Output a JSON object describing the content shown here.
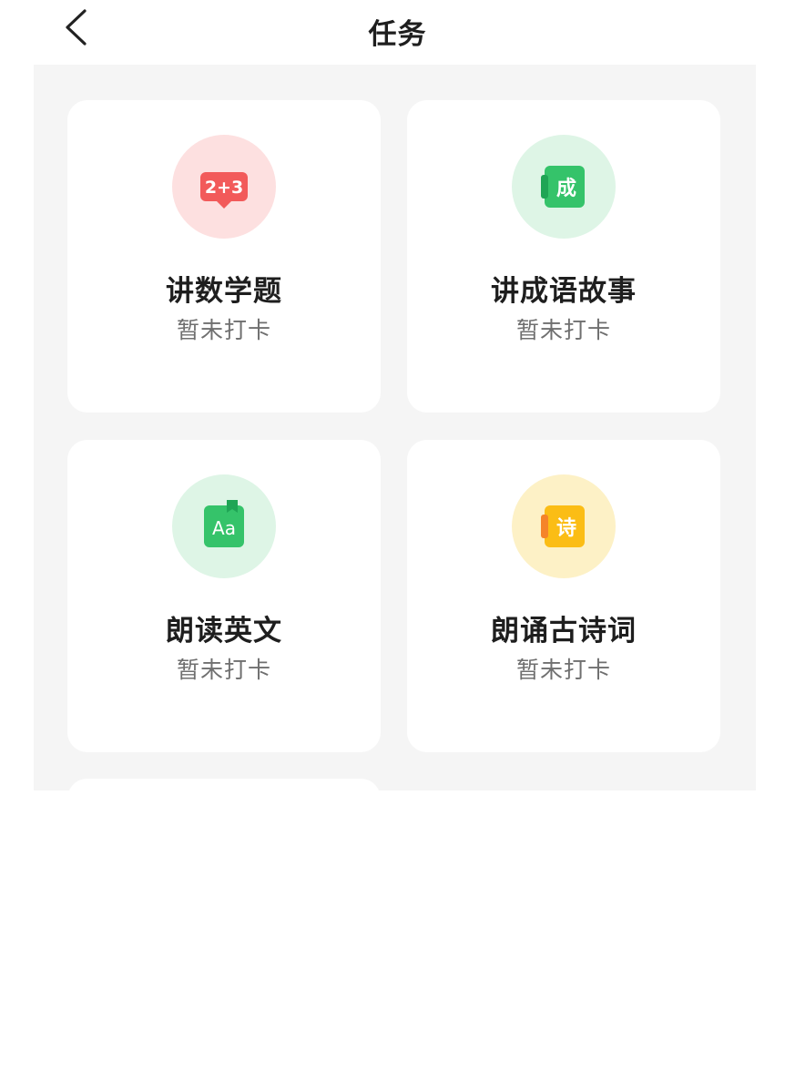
{
  "header": {
    "title": "任务",
    "back_icon": "chevron-left-icon"
  },
  "tasks": [
    {
      "title": "讲数学题",
      "status": "暂未打卡",
      "icon": "math-bubble-icon",
      "icon_text": "2+3",
      "circle_color": "#fde0e0",
      "icon_color": "#f25a5a"
    },
    {
      "title": "讲成语故事",
      "status": "暂未打卡",
      "icon": "idiom-book-icon",
      "icon_text": "成",
      "circle_color": "#def5e6",
      "icon_color": "#35c36a"
    },
    {
      "title": "朗读英文",
      "status": "暂未打卡",
      "icon": "english-book-icon",
      "icon_text": "Aa",
      "circle_color": "#def5e6",
      "icon_color": "#35c36a"
    },
    {
      "title": "朗诵古诗词",
      "status": "暂未打卡",
      "icon": "poem-book-icon",
      "icon_text": "诗",
      "circle_color": "#fdf1c6",
      "icon_color": "#fbbd15"
    }
  ]
}
